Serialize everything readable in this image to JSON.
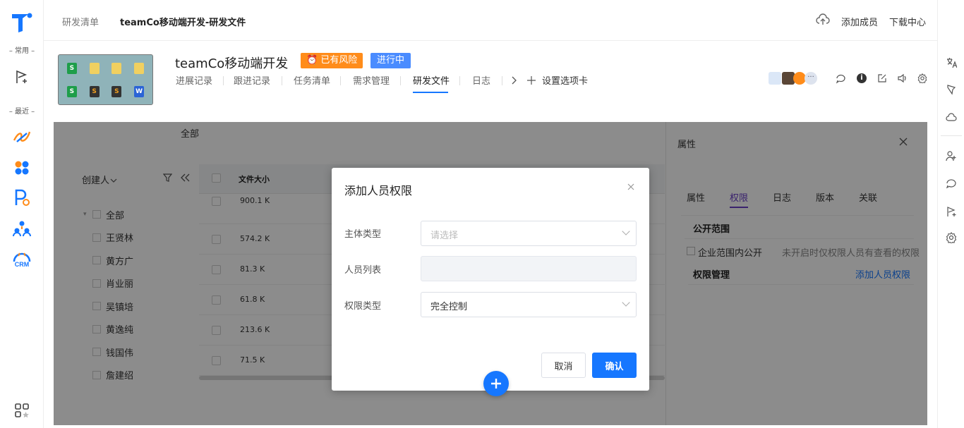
{
  "topbar": {
    "breadcrumb_root": "研发清单",
    "breadcrumb_current": "teamCo移动端开发-研发文件",
    "add_member": "添加成员",
    "download_center": "下载中心"
  },
  "leftnav": {
    "section_common": "– 常用 –",
    "section_recent": "– 最近 –",
    "crm_label": "CRM"
  },
  "project": {
    "title": "teamCo移动端开发",
    "risk_badge": "⏰ 已有风险",
    "status_badge": "进行中",
    "thumb_files": [
      "S",
      "",
      "",
      "",
      "S",
      "",
      "",
      "W"
    ],
    "tabs": [
      "进展记录",
      "跟进记录",
      "任务清单",
      "需求管理",
      "研发文件",
      "日志"
    ],
    "active_tab": "研发文件",
    "settings_tab": "设置选项卡"
  },
  "filelist": {
    "scope_label": "全部",
    "creator_label": "创建人",
    "column_size": "文件大小",
    "creators": [
      "全部",
      "王贤林",
      "黄方广",
      "肖业丽",
      "吴镇培",
      "黄逸纯",
      "钱国伟",
      "詹建绍"
    ],
    "sizes": [
      "900.1 K",
      "574.2 K",
      "81.3 K",
      "61.8 K",
      "213.6 K",
      "71.5 K"
    ]
  },
  "panel": {
    "title": "属性",
    "tabs": [
      "属性",
      "权限",
      "日志",
      "版本",
      "关联"
    ],
    "active_tab": "权限",
    "public_scope": "公开范围",
    "enterprise_public": "企业范围内公开",
    "enterprise_hint": "未开启时仅权限人员有查看的权限",
    "perm_manage": "权限管理",
    "add_perm_link": "添加人员权限"
  },
  "modal": {
    "title": "添加人员权限",
    "subject_type_label": "主体类型",
    "subject_type_placeholder": "请选择",
    "member_list_label": "人员列表",
    "perm_type_label": "权限类型",
    "perm_type_value": "完全控制",
    "cancel": "取消",
    "confirm": "确认"
  },
  "colors": {
    "brand": "#1677ff",
    "risk": "#ff8c1a",
    "status": "#4a8cff",
    "panel_accent": "#6a3fc7"
  }
}
